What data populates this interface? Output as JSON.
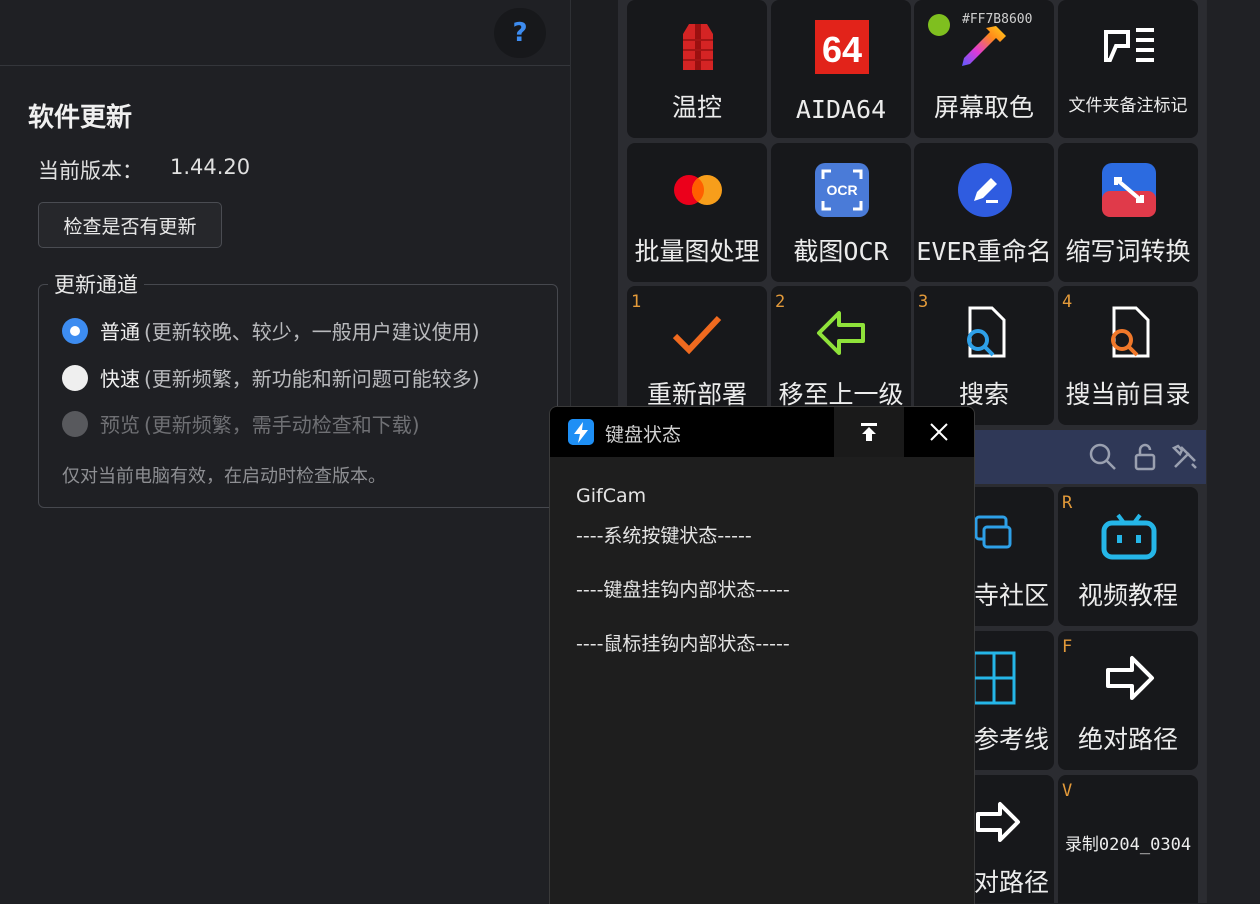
{
  "settings": {
    "help_label": "?",
    "section_title": "软件更新",
    "version_label": "当前版本：",
    "version_value": "1.44.20",
    "check_button": "检查是否有更新",
    "channel_legend": "更新通道",
    "channels": [
      {
        "name": "普通",
        "desc": "(更新较晚、较少，一般用户建议使用)",
        "state": "selected"
      },
      {
        "name": "快速",
        "desc": "(更新频繁，新功能和新问题可能较多)",
        "state": "unselected"
      },
      {
        "name": "预览",
        "desc": "(更新频繁，需手动检查和下载)",
        "state": "disabled"
      }
    ],
    "note": "仅对当前电脑有效，在启动时检查版本。"
  },
  "launcher": {
    "color_hex": "#FF7B8600",
    "tiles": [
      {
        "label": "温控",
        "key": "",
        "icon": "vest-icon"
      },
      {
        "label": "AIDA64",
        "key": "",
        "icon": "aida64-icon"
      },
      {
        "label": "屏幕取色",
        "key": "",
        "icon": "color-picker-icon"
      },
      {
        "label": "文件夹备注标记",
        "key": "",
        "icon": "folder-note-icon"
      },
      {
        "label": "批量图处理",
        "key": "",
        "icon": "mastercard-icon"
      },
      {
        "label": "截图OCR",
        "key": "",
        "icon": "ocr-icon"
      },
      {
        "label": "EVER重命名",
        "key": "",
        "icon": "pen-icon"
      },
      {
        "label": "缩写词转换",
        "key": "",
        "icon": "convert-icon"
      },
      {
        "label": "重新部署",
        "key": "1",
        "icon": "check-icon"
      },
      {
        "label": "移至上一级",
        "key": "2",
        "icon": "arrow-left-icon"
      },
      {
        "label": "搜索",
        "key": "3",
        "icon": "search-file-icon"
      },
      {
        "label": "搜当前目录",
        "key": "4",
        "icon": "search-folder-icon"
      },
      {
        "label": "视频教程",
        "key": "R",
        "icon": "bilibili-icon"
      },
      {
        "label": "绝对路径",
        "key": "F",
        "icon": "arrow-right-icon"
      },
      {
        "label": "录制0204_0304",
        "key": "V",
        "icon": ""
      }
    ],
    "partial_labels": [
      "寺社区",
      "参考线",
      "对路径"
    ]
  },
  "popup": {
    "title": "键盘状态",
    "lines": [
      "GifCam",
      "----系统按键状态-----",
      "----键盘挂钩内部状态-----",
      "----鼠标挂钩内部状态-----"
    ]
  }
}
